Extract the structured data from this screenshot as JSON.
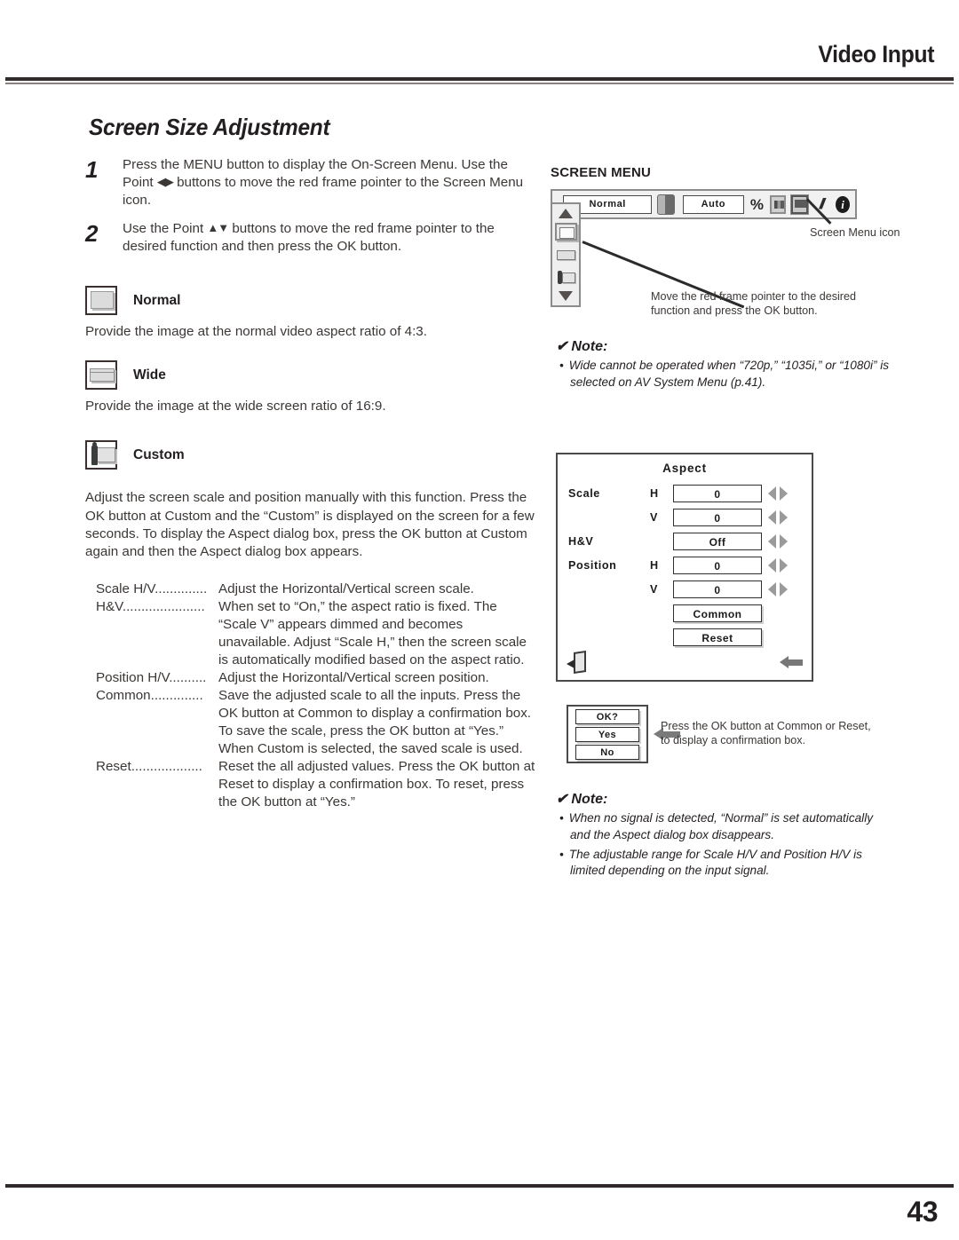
{
  "header": {
    "title": "Video Input"
  },
  "section": {
    "heading": "Screen Size Adjustment"
  },
  "steps": [
    {
      "num": "1",
      "text_a": "Press the MENU button to display the On-Screen Menu. Use the Point ",
      "glyph": "◀▶",
      "text_b": " buttons to move the red frame pointer to the Screen Menu icon."
    },
    {
      "num": "2",
      "text_a": "Use the Point ",
      "glyph": "▲▼",
      "text_b": " buttons to move the red frame pointer to the desired function and then press the OK button."
    }
  ],
  "modes": [
    {
      "label": "Normal",
      "desc": "Provide the image at the normal video aspect ratio of 4:3.",
      "icon": "screen-normal-icon"
    },
    {
      "label": "Wide",
      "desc": "Provide the image at the wide screen ratio of 16:9.",
      "icon": "screen-wide-icon"
    },
    {
      "label": "Custom",
      "desc": "",
      "icon": "screen-custom-icon"
    }
  ],
  "custom_paragraph": "Adjust the screen scale and position manually with this function. Press the OK button at Custom and the “Custom” is displayed on the screen for a few seconds. To display the Aspect dialog box, press the OK button at Custom again and then the Aspect dialog box appears.",
  "definitions": [
    {
      "term": "Scale H/V",
      "dots": "..............",
      "desc": "Adjust the Horizontal/Vertical screen scale."
    },
    {
      "term": "H&V",
      "dots": "......................",
      "desc": "When set to “On,” the aspect ratio is fixed. The “Scale V” appears dimmed and becomes unavailable. Adjust “Scale H,” then the screen scale is automatically modified based on the aspect ratio."
    },
    {
      "term": "Position H/V",
      "dots": "..........",
      "desc": "Adjust the Horizontal/Vertical screen position."
    },
    {
      "term": "Common",
      "dots": "..............",
      "desc": "Save the adjusted scale to all the inputs. Press the OK button at Common to display a confirmation box. To save the scale, press the OK button at “Yes.” When Custom is selected, the saved scale is used."
    },
    {
      "term": "Reset",
      "dots": "...................",
      "desc": "Reset the all adjusted values. Press the OK button at Reset to display a confirmation box. To reset, press the OK button at “Yes.”"
    }
  ],
  "screen_menu": {
    "title": "SCREEN MENU",
    "bar": {
      "normal_field": "Normal",
      "auto_field": "Auto",
      "icons": [
        "input-icon",
        "color-adjust-icon",
        "image-select-icon",
        "screen-menu-icon",
        "setting-icon",
        "information-icon"
      ]
    },
    "side_items": [
      "scroll-up-icon",
      "screen-normal-icon",
      "screen-wide-icon",
      "screen-custom-icon",
      "scroll-down-icon"
    ],
    "callout_icon": "Screen Menu icon",
    "callout_pointer": "Move the red frame pointer to the desired function and press the OK button."
  },
  "note_top": {
    "check": "✔",
    "heading": "Note:",
    "items": [
      "Wide cannot be operated when “720p,” “1035i,” or “1080i” is selected on AV System Menu (p.41)."
    ]
  },
  "aspect_dialog": {
    "title": "Aspect",
    "rows": [
      {
        "label": "Scale",
        "axis": "H",
        "value": "0",
        "type": "value"
      },
      {
        "label": "",
        "axis": "V",
        "value": "0",
        "type": "value"
      },
      {
        "label": "H&V",
        "axis": "",
        "value": "Off",
        "type": "value"
      },
      {
        "label": "Position",
        "axis": "H",
        "value": "0",
        "type": "value"
      },
      {
        "label": "",
        "axis": "V",
        "value": "0",
        "type": "value"
      },
      {
        "label": "",
        "axis": "",
        "value": "Common",
        "type": "button"
      },
      {
        "label": "",
        "axis": "",
        "value": "Reset",
        "type": "button"
      }
    ],
    "quit_icon": "quit-icon",
    "back_icon": "back-arrow-icon"
  },
  "confirm": {
    "title": "OK?",
    "yes": "Yes",
    "no": "No",
    "caption": "Press the OK button at Common or Reset, to display a confirmation box."
  },
  "note_bottom": {
    "check": "✔",
    "heading": "Note:",
    "items": [
      "When no signal is detected, “Normal” is set automatically and the Aspect dialog box disappears.",
      "The adjustable range for Scale H/V and Position H/V is limited depending on the input signal."
    ]
  },
  "footer": {
    "page_number": "43"
  }
}
